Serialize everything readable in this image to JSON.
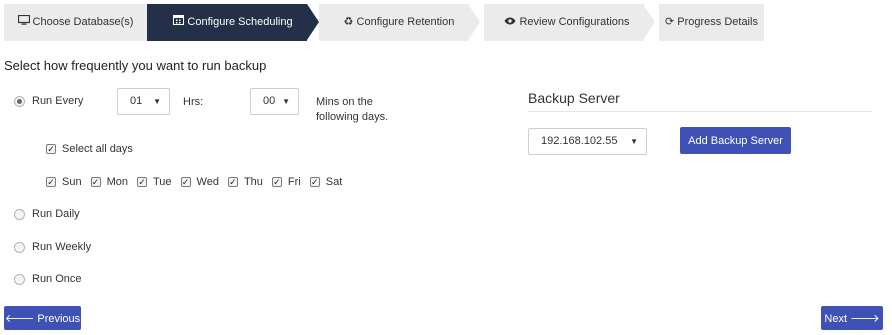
{
  "wizard": {
    "steps": [
      {
        "label": "Choose Database(s)",
        "icon": "monitor-icon",
        "active": false
      },
      {
        "label": "Configure Scheduling",
        "icon": "calendar-icon",
        "active": true
      },
      {
        "label": "Configure Retention",
        "icon": "recycle-icon",
        "active": false
      },
      {
        "label": "Review Configurations",
        "icon": "eye-icon",
        "active": false
      },
      {
        "label": "Progress Details",
        "icon": "refresh-icon",
        "active": false
      }
    ]
  },
  "schedule": {
    "title": "Select how frequently you want to run backup",
    "run_every": {
      "label": "Run Every",
      "checked": true,
      "hours_value": "01",
      "hrs_label": "Hrs:",
      "mins_value": "00",
      "mins_suffix_line1": "Mins on the",
      "mins_suffix_line2": "following days."
    },
    "select_all": {
      "label": "Select all days",
      "checked": true
    },
    "days": [
      {
        "label": "Sun",
        "checked": true
      },
      {
        "label": "Mon",
        "checked": true
      },
      {
        "label": "Tue",
        "checked": true
      },
      {
        "label": "Wed",
        "checked": true
      },
      {
        "label": "Thu",
        "checked": true
      },
      {
        "label": "Fri",
        "checked": true
      },
      {
        "label": "Sat",
        "checked": true
      }
    ],
    "run_daily": {
      "label": "Run Daily",
      "checked": false
    },
    "run_weekly": {
      "label": "Run Weekly",
      "checked": false
    },
    "run_once": {
      "label": "Run Once",
      "checked": false
    }
  },
  "backup_server": {
    "title": "Backup Server",
    "selected": "192.168.102.55",
    "add_button": "Add Backup Server"
  },
  "navigation": {
    "previous": "Previous",
    "next": "Next"
  },
  "colors": {
    "active_step": "#233047",
    "inactive_step": "#ebebeb",
    "primary_button": "#3f51b5"
  }
}
